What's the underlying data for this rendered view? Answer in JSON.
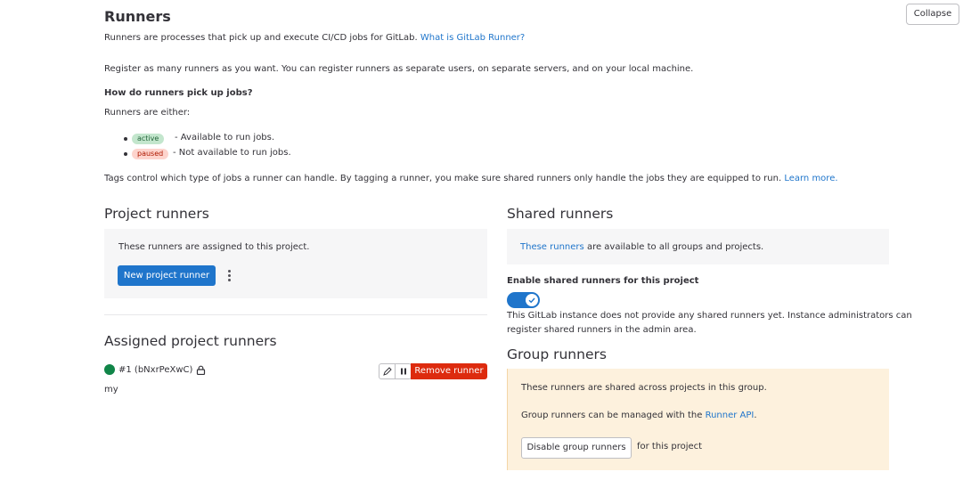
{
  "header": {
    "title": "Runners",
    "collapse_label": "Collapse",
    "intro_text": "Runners are processes that pick up and execute CI/CD jobs for GitLab.",
    "intro_link": "What is GitLab Runner?",
    "register_text": "Register as many runners as you want. You can register runners as separate users, on separate servers, and on your local machine.",
    "how_title": "How do runners pick up jobs?",
    "either_text": "Runners are either:",
    "states": [
      {
        "badge": "active",
        "text": "- Available to run jobs."
      },
      {
        "badge": "paused",
        "text": "- Not available to run jobs."
      }
    ],
    "tags_text": "Tags control which type of jobs a runner can handle. By tagging a runner, you make sure shared runners only handle the jobs they are equipped to run.",
    "tags_link": "Learn more."
  },
  "project_runners": {
    "title": "Project runners",
    "description": "These runners are assigned to this project.",
    "new_button": "New project runner"
  },
  "assigned": {
    "title": "Assigned project runners",
    "runner_id": "#1 (bNxrPeXwC)",
    "runner_description": "my",
    "remove_button": "Remove runner"
  },
  "shared_runners": {
    "title": "Shared runners",
    "link": "These runners",
    "description": "are available to all groups and projects.",
    "enable_label": "Enable shared runners for this project",
    "enabled": true,
    "note_line1": "This GitLab instance does not provide any shared runners yet. Instance administrators can",
    "note_line2": "register shared runners in the admin area."
  },
  "group_runners": {
    "title": "Group runners",
    "desc1": "These runners are shared across projects in this group.",
    "desc2_prefix": "Group runners can be managed with the",
    "desc2_link": "Runner API",
    "desc2_suffix": ".",
    "disable_button": "Disable group runners",
    "disable_suffix": "for this project"
  },
  "colors": {
    "primary": "#1f75cb",
    "danger": "#dd2b0e",
    "success": "#108548",
    "warning_bg": "#fdf1dd"
  }
}
